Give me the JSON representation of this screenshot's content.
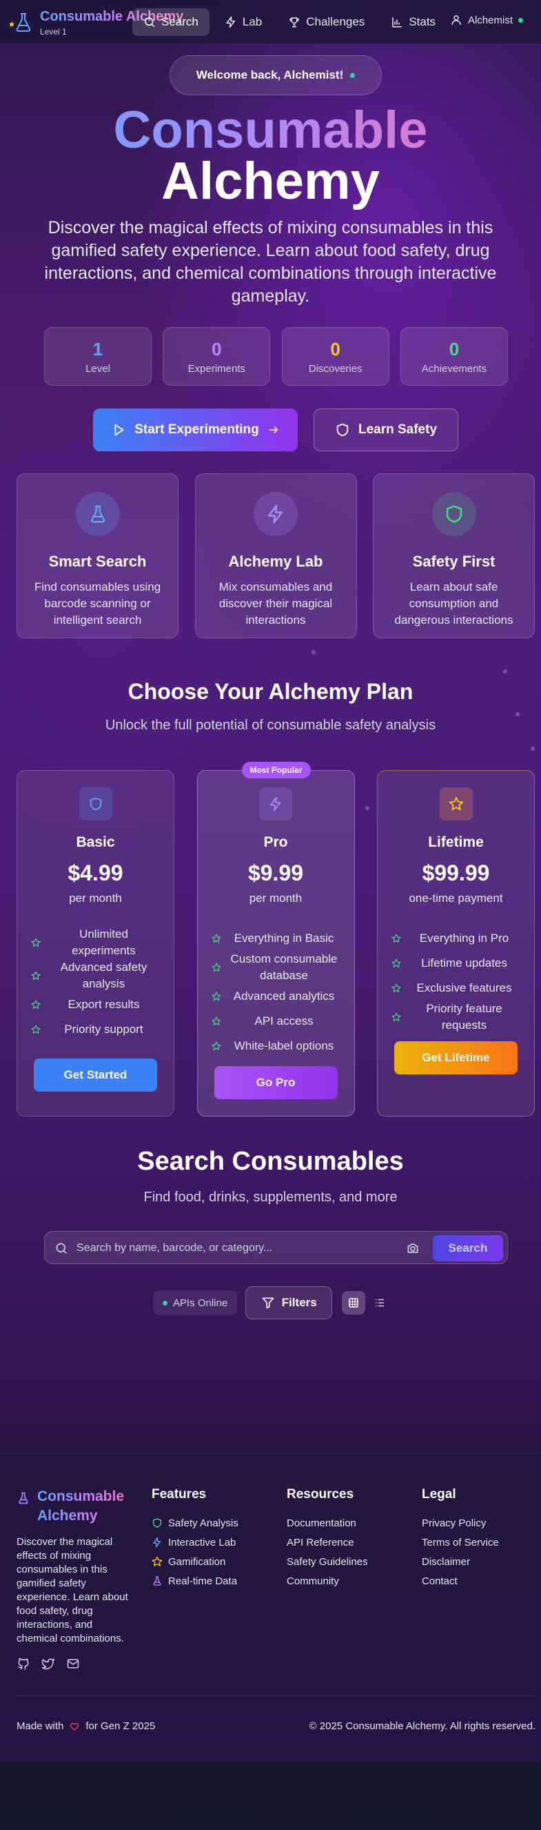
{
  "nav": {
    "brand_title": "Consumable Alchemy",
    "level": "Level 1",
    "links": [
      {
        "label": "Search",
        "icon": "search-icon"
      },
      {
        "label": "Lab",
        "icon": "lightning-icon"
      },
      {
        "label": "Challenges",
        "icon": "trophy-icon"
      },
      {
        "label": "Stats",
        "icon": "bar-chart-icon"
      }
    ],
    "user": "Alchemist"
  },
  "hero": {
    "welcome": "Welcome back, Alchemist!",
    "title_line1": "Consumable",
    "title_line2": "Alchemy",
    "description": "Discover the magical effects of mixing consumables in this gamified safety experience. Learn about food safety, drug interactions, and chemical combinations through interactive gameplay.",
    "stats": [
      {
        "value": "1",
        "label": "Level",
        "color": "#60a5fa"
      },
      {
        "value": "0",
        "label": "Experiments",
        "color": "#c084fc"
      },
      {
        "value": "0",
        "label": "Discoveries",
        "color": "#facc15"
      },
      {
        "value": "0",
        "label": "Achievements",
        "color": "#4ade80"
      }
    ],
    "primary_cta": "Start Experimenting",
    "secondary_cta": "Learn Safety"
  },
  "features": [
    {
      "title": "Smart Search",
      "desc": "Find consumables using barcode scanning or intelligent search",
      "icon": "flask-icon",
      "color": "#60a5fa"
    },
    {
      "title": "Alchemy Lab",
      "desc": "Mix consumables and discover their magical interactions",
      "icon": "lightning-icon",
      "color": "#a78bfa"
    },
    {
      "title": "Safety First",
      "desc": "Learn about safe consumption and dangerous interactions",
      "icon": "shield-icon",
      "color": "#4ade80"
    }
  ],
  "plans_section": {
    "title": "Choose Your Alchemy Plan",
    "subtitle": "Unlock the full potential of consumable safety analysis",
    "plans": [
      {
        "name": "Basic",
        "price": "$4.99",
        "period": "per month",
        "badge": "",
        "button": "Get Started",
        "features": [
          "Unlimited experiments",
          "Advanced safety analysis",
          "Export results",
          "Priority support"
        ]
      },
      {
        "name": "Pro",
        "price": "$9.99",
        "period": "per month",
        "badge": "Most Popular",
        "button": "Go Pro",
        "features": [
          "Everything in Basic",
          "Custom consumable database",
          "Advanced analytics",
          "API access",
          "White-label options"
        ]
      },
      {
        "name": "Lifetime",
        "price": "$99.99",
        "period": "one-time payment",
        "badge": "",
        "button": "Get Lifetime",
        "features": [
          "Everything in Pro",
          "Lifetime updates",
          "Exclusive features",
          "Priority feature requests"
        ]
      }
    ]
  },
  "search_section": {
    "title": "Search Consumables",
    "subtitle": "Find food, drinks, supplements, and more",
    "placeholder": "Search by name, barcode, or category...",
    "button": "Search",
    "api_status": "APIs Online",
    "filters": "Filters"
  },
  "footer": {
    "brand_title": "Consumable Alchemy",
    "description": "Discover the magical effects of mixing consumables in this gamified safety experience. Learn about food safety, drug interactions, and chemical combinations.",
    "features_heading": "Features",
    "features": [
      {
        "label": "Safety Analysis",
        "icon": "shield-icon"
      },
      {
        "label": "Interactive Lab",
        "icon": "lightning-icon"
      },
      {
        "label": "Gamification",
        "icon": "star-icon"
      },
      {
        "label": "Real-time Data",
        "icon": "flask-icon"
      }
    ],
    "resources_heading": "Resources",
    "resources": [
      "Documentation",
      "API Reference",
      "Safety Guidelines",
      "Community"
    ],
    "legal_heading": "Legal",
    "legal": [
      "Privacy Policy",
      "Terms of Service",
      "Disclaimer",
      "Contact"
    ],
    "made_with_prefix": "Made with",
    "made_with_suffix": "for Gen Z 2025",
    "copyright": "© 2025 Consumable Alchemy. All rights reserved."
  }
}
